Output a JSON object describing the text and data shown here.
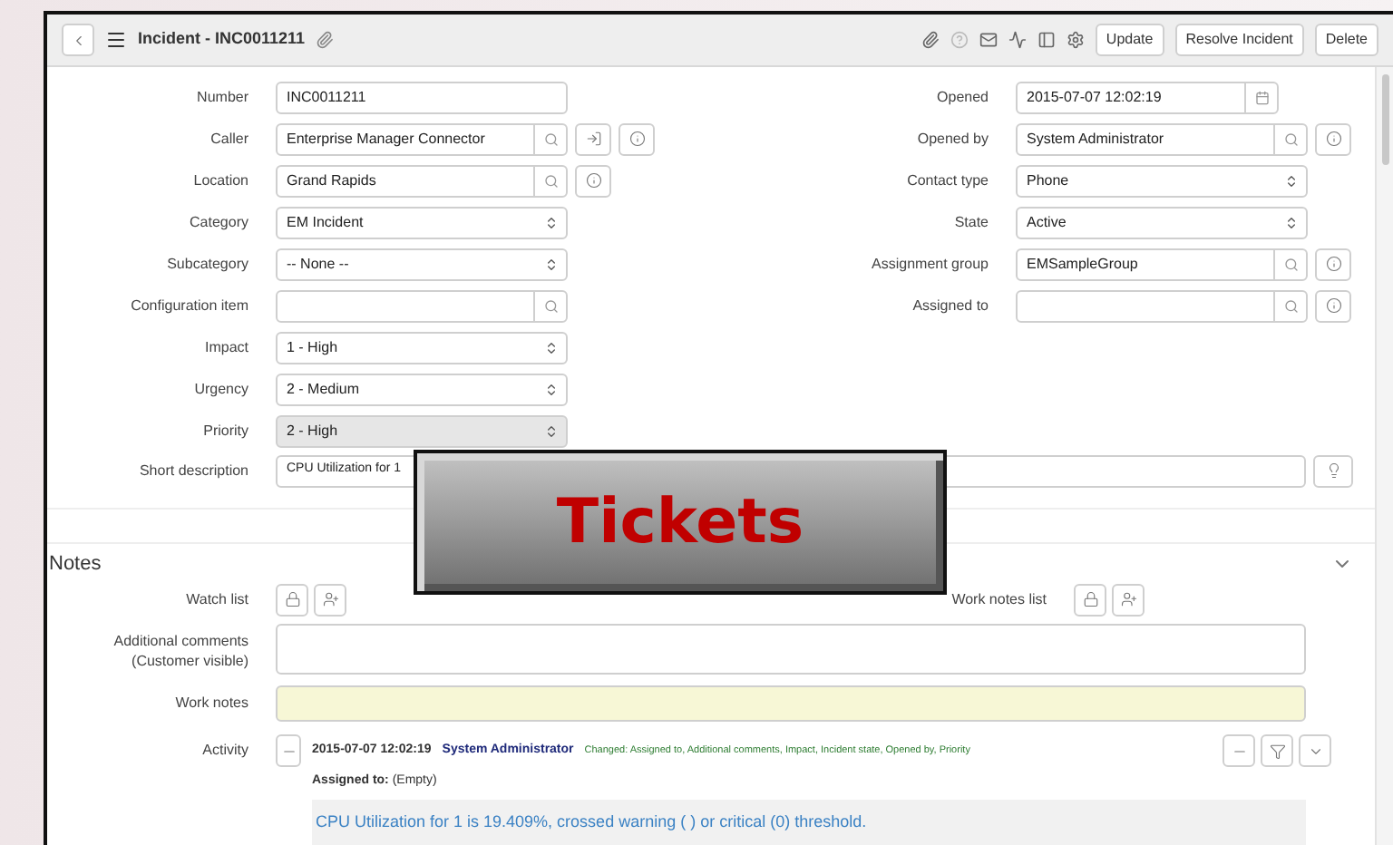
{
  "header": {
    "title": "Incident - INC0011211",
    "buttons": [
      "Update",
      "Resolve Incident",
      "Delete"
    ]
  },
  "left_fields": [
    {
      "label": "Number",
      "value": "INC0011211",
      "kind": "text",
      "readonly": false
    },
    {
      "label": "Caller",
      "value": "Enterprise Manager Connector",
      "kind": "lookup",
      "readonly": false,
      "extras": [
        {
          "kind": "contact"
        },
        {
          "kind": "info"
        }
      ]
    },
    {
      "label": "Location",
      "value": "Grand Rapids",
      "kind": "lookup",
      "readonly": false,
      "extras": [
        {
          "kind": "info"
        }
      ]
    },
    {
      "label": "Category",
      "value": "EM Incident",
      "kind": "select",
      "readonly": false
    },
    {
      "label": "Subcategory",
      "value": "-- None --",
      "kind": "select",
      "readonly": false
    },
    {
      "label": "Configuration item",
      "kind": "lookup",
      "readonly": false
    },
    {
      "label": "Impact",
      "value": "1 - High",
      "kind": "select",
      "readonly": false
    },
    {
      "label": "Urgency",
      "value": "2 - Medium",
      "kind": "select",
      "readonly": false
    },
    {
      "label": "Priority",
      "value": "2 - High",
      "kind": "select",
      "readonly": true
    }
  ],
  "right_fields": [
    {
      "label": "Opened",
      "value": "2015-07-07 12:02:19",
      "kind": "date",
      "readonly": false
    },
    {
      "label": "Opened by",
      "value": "System Administrator",
      "kind": "lookup",
      "readonly": false,
      "extras": [
        {
          "kind": "info"
        }
      ]
    },
    {
      "label": "Contact type",
      "value": "Phone",
      "kind": "select",
      "readonly": false
    },
    {
      "label": "State",
      "value": "Active",
      "kind": "select",
      "readonly": false
    },
    {
      "label": "Assignment group",
      "value": "EMSampleGroup",
      "kind": "lookup",
      "readonly": false,
      "extras": [
        {
          "kind": "info"
        }
      ]
    },
    {
      "label": "Assigned to",
      "kind": "lookup",
      "readonly": false,
      "extras": [
        {
          "kind": "info"
        }
      ]
    }
  ],
  "short_description": {
    "label": "Short description",
    "value": "CPU Utilization for 1"
  },
  "notes": {
    "title": "Notes",
    "watch_list_label": "Watch list",
    "work_notes_list_label": "Work notes list",
    "comments_label": "Additional comments (Customer visible)",
    "work_notes_label": "Work notes"
  },
  "activity": {
    "label": "Activity",
    "date": "2015-07-07 12:02:19",
    "author": "System Administrator",
    "changes": "Changed: Assigned to, Additional comments, Impact, Incident state, Opened by, Priority",
    "detail": "**Assigned to:** (Empty)",
    "message": "CPU Utilization for 1 is 19.409%, crossed warning ( ) or critical (0) threshold."
  },
  "overlay": {
    "text": "Tickets"
  }
}
